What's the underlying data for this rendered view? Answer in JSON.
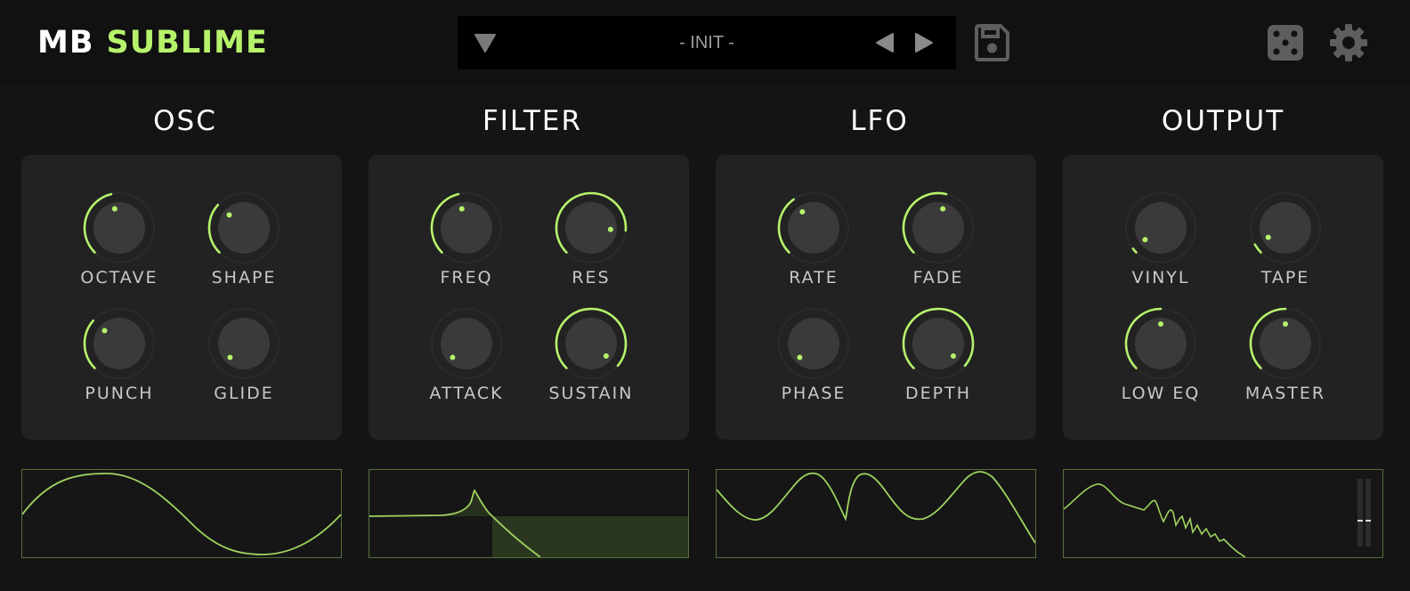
{
  "header": {
    "logo_part1": "MB",
    "logo_part2": "SUBLIME",
    "preset_name": "- INIT -",
    "icons": [
      "dropdown-triangle-icon",
      "prev-arrow-icon",
      "next-arrow-icon",
      "save-icon",
      "dice-icon",
      "gear-icon"
    ]
  },
  "colors": {
    "accent": "#b6f36b",
    "panel": "#222222",
    "background": "#141414",
    "display_border": "#55703a"
  },
  "sections": [
    {
      "title": "OSC",
      "knobs": [
        {
          "label": "OCTAVE",
          "value": 0.45
        },
        {
          "label": "SHAPE",
          "value": 0.32
        },
        {
          "label": "PUNCH",
          "value": 0.32
        },
        {
          "label": "GLIDE",
          "value": 0.0
        }
      ]
    },
    {
      "title": "FILTER",
      "knobs": [
        {
          "label": "FREQ",
          "value": 0.45
        },
        {
          "label": "RES",
          "value": 0.85
        },
        {
          "label": "ATTACK",
          "value": 0.0
        },
        {
          "label": "SUSTAIN",
          "value": 0.98
        }
      ]
    },
    {
      "title": "LFO",
      "knobs": [
        {
          "label": "RATE",
          "value": 0.37
        },
        {
          "label": "FADE",
          "value": 0.55
        },
        {
          "label": "PHASE",
          "value": 0.0
        },
        {
          "label": "DEPTH",
          "value": 0.98
        }
      ]
    },
    {
      "title": "OUTPUT",
      "knobs": [
        {
          "label": "VINYL",
          "value": 0.03
        },
        {
          "label": "TAPE",
          "value": 0.06
        },
        {
          "label": "LOW EQ",
          "value": 0.5
        },
        {
          "label": "MASTER",
          "value": 0.5
        }
      ]
    }
  ]
}
